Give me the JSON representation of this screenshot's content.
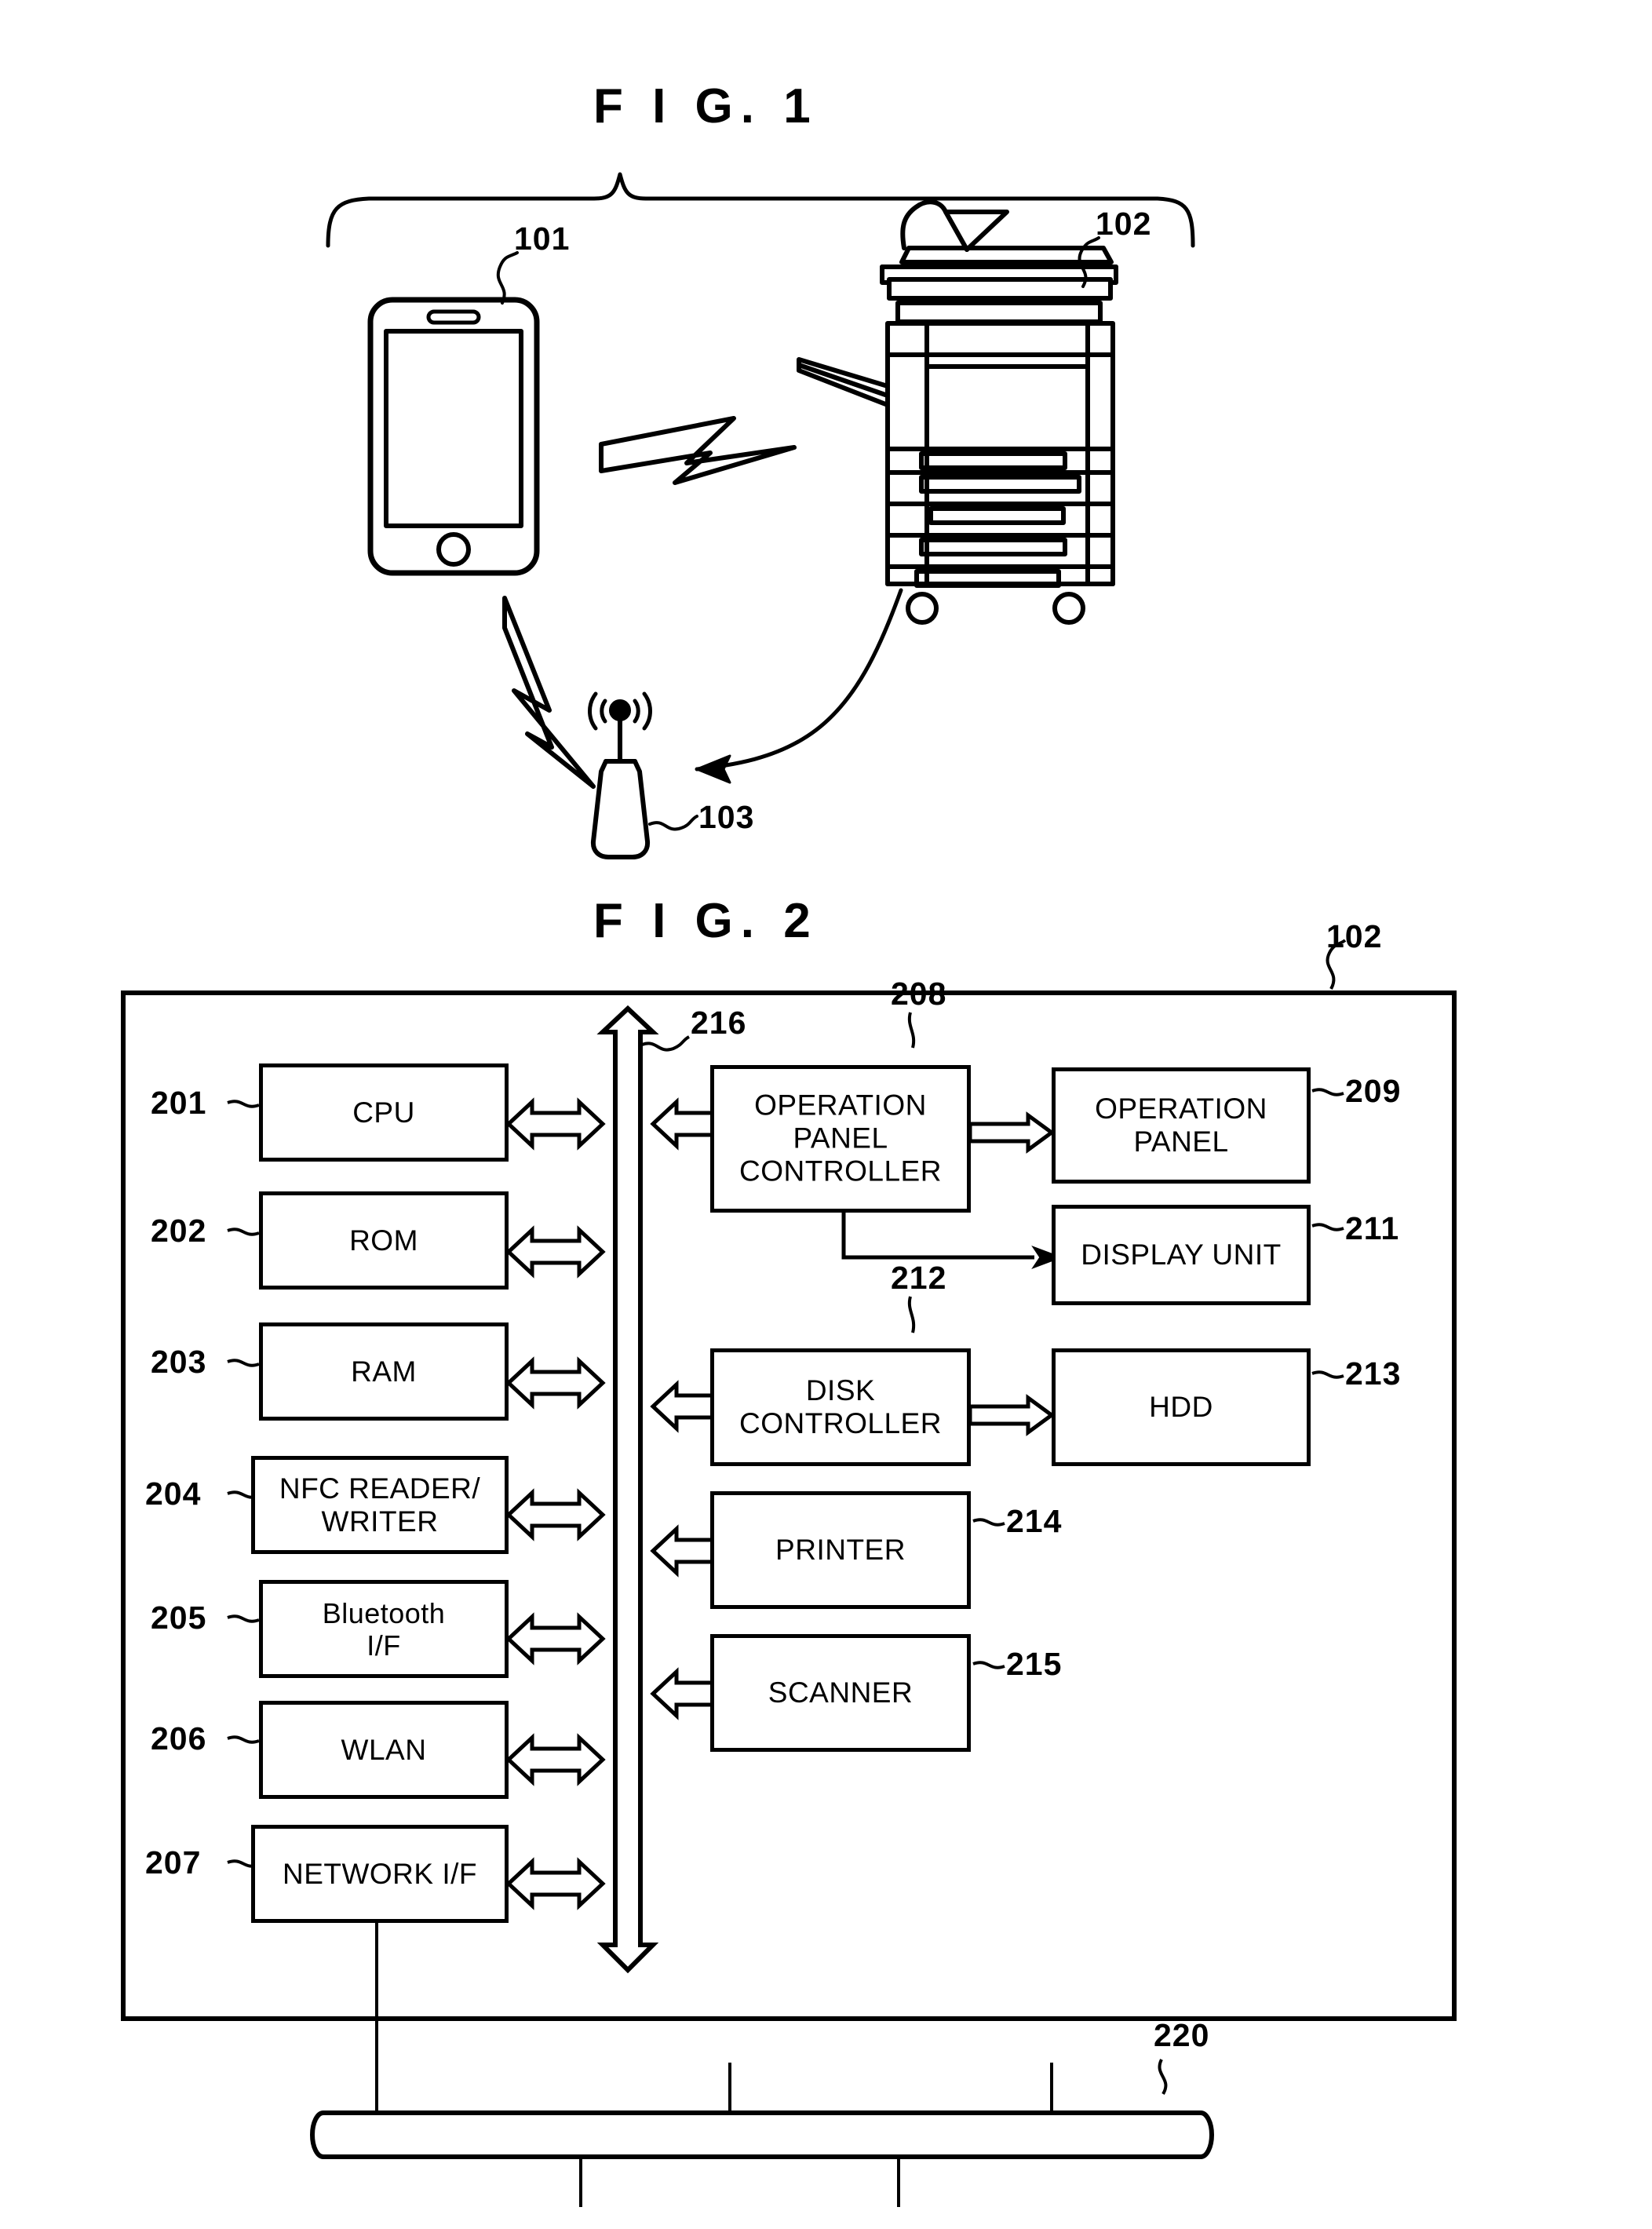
{
  "figures": [
    {
      "id": "fig1",
      "title": "F I G. 1",
      "caption_refs": [
        {
          "id": "f1-101",
          "label": "101"
        },
        {
          "id": "f1-102",
          "label": "102"
        },
        {
          "id": "f1-103",
          "label": "103"
        },
        {
          "id": "f1-bracket-102",
          "label": "102"
        }
      ],
      "elements": [
        {
          "name": "mobile-terminal",
          "ref": "101"
        },
        {
          "name": "multifunction-peripheral",
          "ref": "102"
        },
        {
          "name": "wireless-access-point",
          "ref": "103"
        }
      ]
    },
    {
      "id": "fig2",
      "title": "F I G. 2",
      "device_ref": "102",
      "bus": {
        "ref": "216"
      },
      "network_cable": {
        "ref": "220"
      },
      "left_blocks": [
        {
          "ref": "201",
          "label": "CPU",
          "case": "upper"
        },
        {
          "ref": "202",
          "label": "ROM",
          "case": "upper"
        },
        {
          "ref": "203",
          "label": "RAM",
          "case": "upper"
        },
        {
          "ref": "204",
          "label": "NFC READER/\nWRITER",
          "case": "upper"
        },
        {
          "ref": "205",
          "label": "Bluetooth\nI/F",
          "case": "mixed"
        },
        {
          "ref": "206",
          "label": "WLAN",
          "case": "upper"
        },
        {
          "ref": "207",
          "label": "NETWORK I/F",
          "case": "upper"
        }
      ],
      "right_blocks": [
        {
          "ref": "208",
          "label": "OPERATION\nPANEL\nCONTROLLER"
        },
        {
          "ref": "209",
          "label": "OPERATION\nPANEL"
        },
        {
          "ref": "211",
          "label": "DISPLAY UNIT"
        },
        {
          "ref": "212",
          "label": "DISK\nCONTROLLER"
        },
        {
          "ref": "213",
          "label": "HDD"
        },
        {
          "ref": "214",
          "label": "PRINTER"
        },
        {
          "ref": "215",
          "label": "SCANNER"
        }
      ]
    }
  ],
  "colors": {
    "ink": "#000000",
    "paper": "#ffffff"
  }
}
